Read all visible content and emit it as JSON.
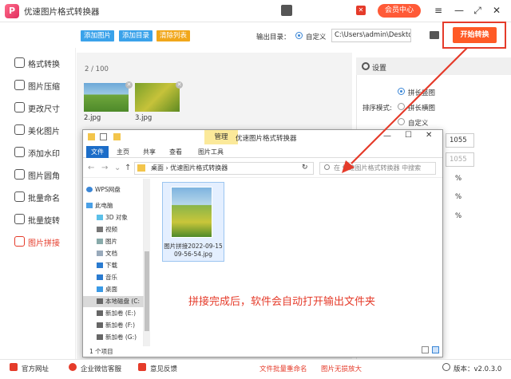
{
  "app": {
    "title": "优速图片格式转换器",
    "vip_label": "会员中心"
  },
  "toolbar": {
    "add_image": "添加图片",
    "add_folder": "添加目录",
    "clear_list": "清除列表",
    "outdir_label": "输出目录：",
    "custom_label": "自定义",
    "outdir_value": "C:\\Users\\admin\\Deskto",
    "start_label": "开始转换"
  },
  "sidebar": {
    "items": [
      {
        "label": "格式转换"
      },
      {
        "label": "图片压缩"
      },
      {
        "label": "更改尺寸"
      },
      {
        "label": "美化图片"
      },
      {
        "label": "添加水印"
      },
      {
        "label": "图片圆角"
      },
      {
        "label": "批量命名"
      },
      {
        "label": "批量旋转"
      },
      {
        "label": "图片拼接"
      }
    ]
  },
  "list": {
    "counter": "2 / 100",
    "files": [
      {
        "name": "2.jpg"
      },
      {
        "name": "3.jpg"
      }
    ]
  },
  "settings": {
    "title": "设置",
    "mode_label": "排序模式:",
    "options": [
      "拼长竖图",
      "拼长横图",
      "自定义"
    ],
    "width_value": "1055",
    "height_value": "1055",
    "pct": "%"
  },
  "explorer": {
    "manage_tab": "管理",
    "window_title": "优速图片格式转换器",
    "tabs": [
      "文件",
      "主页",
      "共享",
      "查看",
      "图片工具"
    ],
    "path": [
      "桌面",
      "优速图片格式转换器"
    ],
    "search_placeholder": "在 优速图片格式转换器 中搜索",
    "nav": [
      "WPS网盘",
      "此电脑",
      "3D 对象",
      "视频",
      "图片",
      "文档",
      "下载",
      "音乐",
      "桌面",
      "本地磁盘 (C:",
      "新加卷 (E:)",
      "新加卷 (F:)",
      "新加卷 (G:)"
    ],
    "file_name_line1": "图片拼接2022-09-15",
    "file_name_line2": "09-56-54.jpg",
    "status": "1 个项目"
  },
  "annotation": "拼接完成后，软件会自动打开输出文件夹",
  "bottom": {
    "website": "官方网址",
    "wechat": "企业微信客服",
    "feedback": "意见反馈",
    "rename": "文件批量重命名",
    "upscale": "图片无损放大",
    "version": "版本：v2.0.3.0"
  },
  "colors": {
    "accent_red": "#e53b2a",
    "start_orange": "#ff5a26",
    "blue_button": "#3aa2ea",
    "orange_button": "#f1a71b"
  }
}
